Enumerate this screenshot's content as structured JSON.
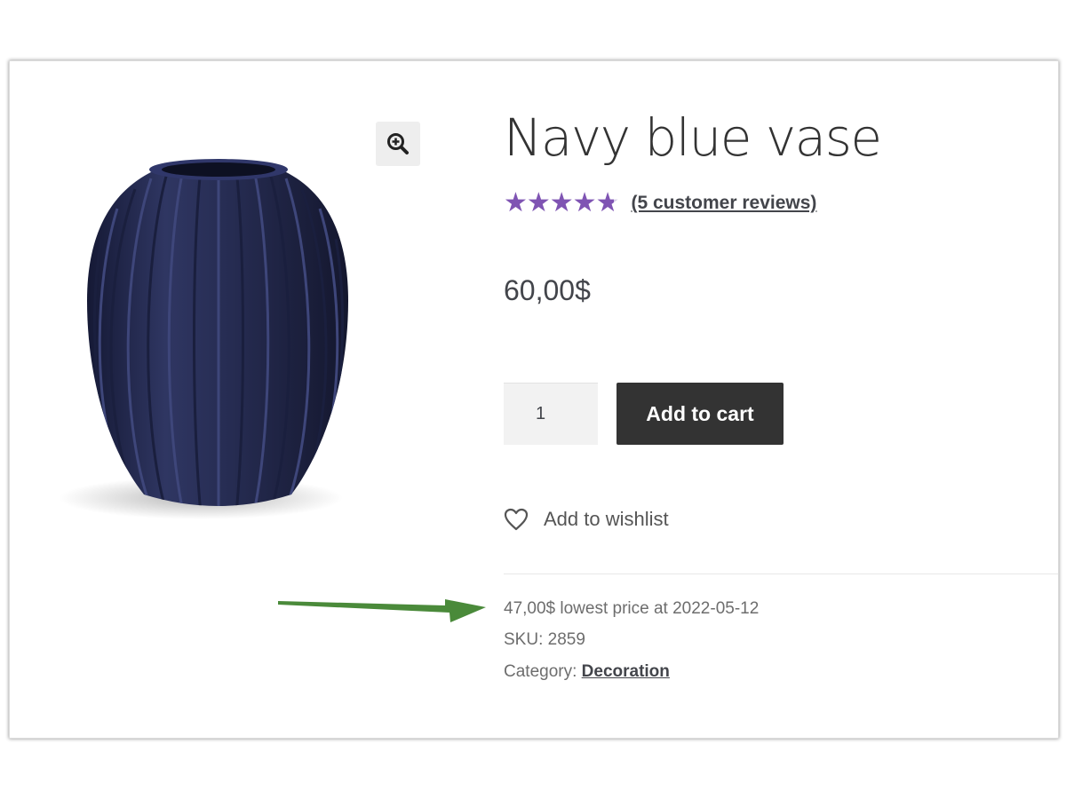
{
  "product": {
    "title": "Navy blue vase",
    "rating_out_of_5": 4.8,
    "stars_glyphs": "★★★★★",
    "reviews_link": "(5 customer reviews)",
    "price": "60,00$",
    "quantity": "1",
    "add_to_cart_label": "Add to cart",
    "wishlist_label": "Add to wishlist",
    "lowest_price_text": "47,00$ lowest price at 2022-05-12",
    "sku_label": "SKU:",
    "sku_value": "2859",
    "category_label": "Category:",
    "category_value": "Decoration"
  },
  "icons": {
    "zoom": "magnifier-plus-icon",
    "wishlist": "heart-outline-icon",
    "annotation": "green-arrow"
  },
  "colors": {
    "vase": "#262c52",
    "star": "#7f54b3",
    "button_bg": "#333333",
    "arrow": "#4a8a3a"
  }
}
